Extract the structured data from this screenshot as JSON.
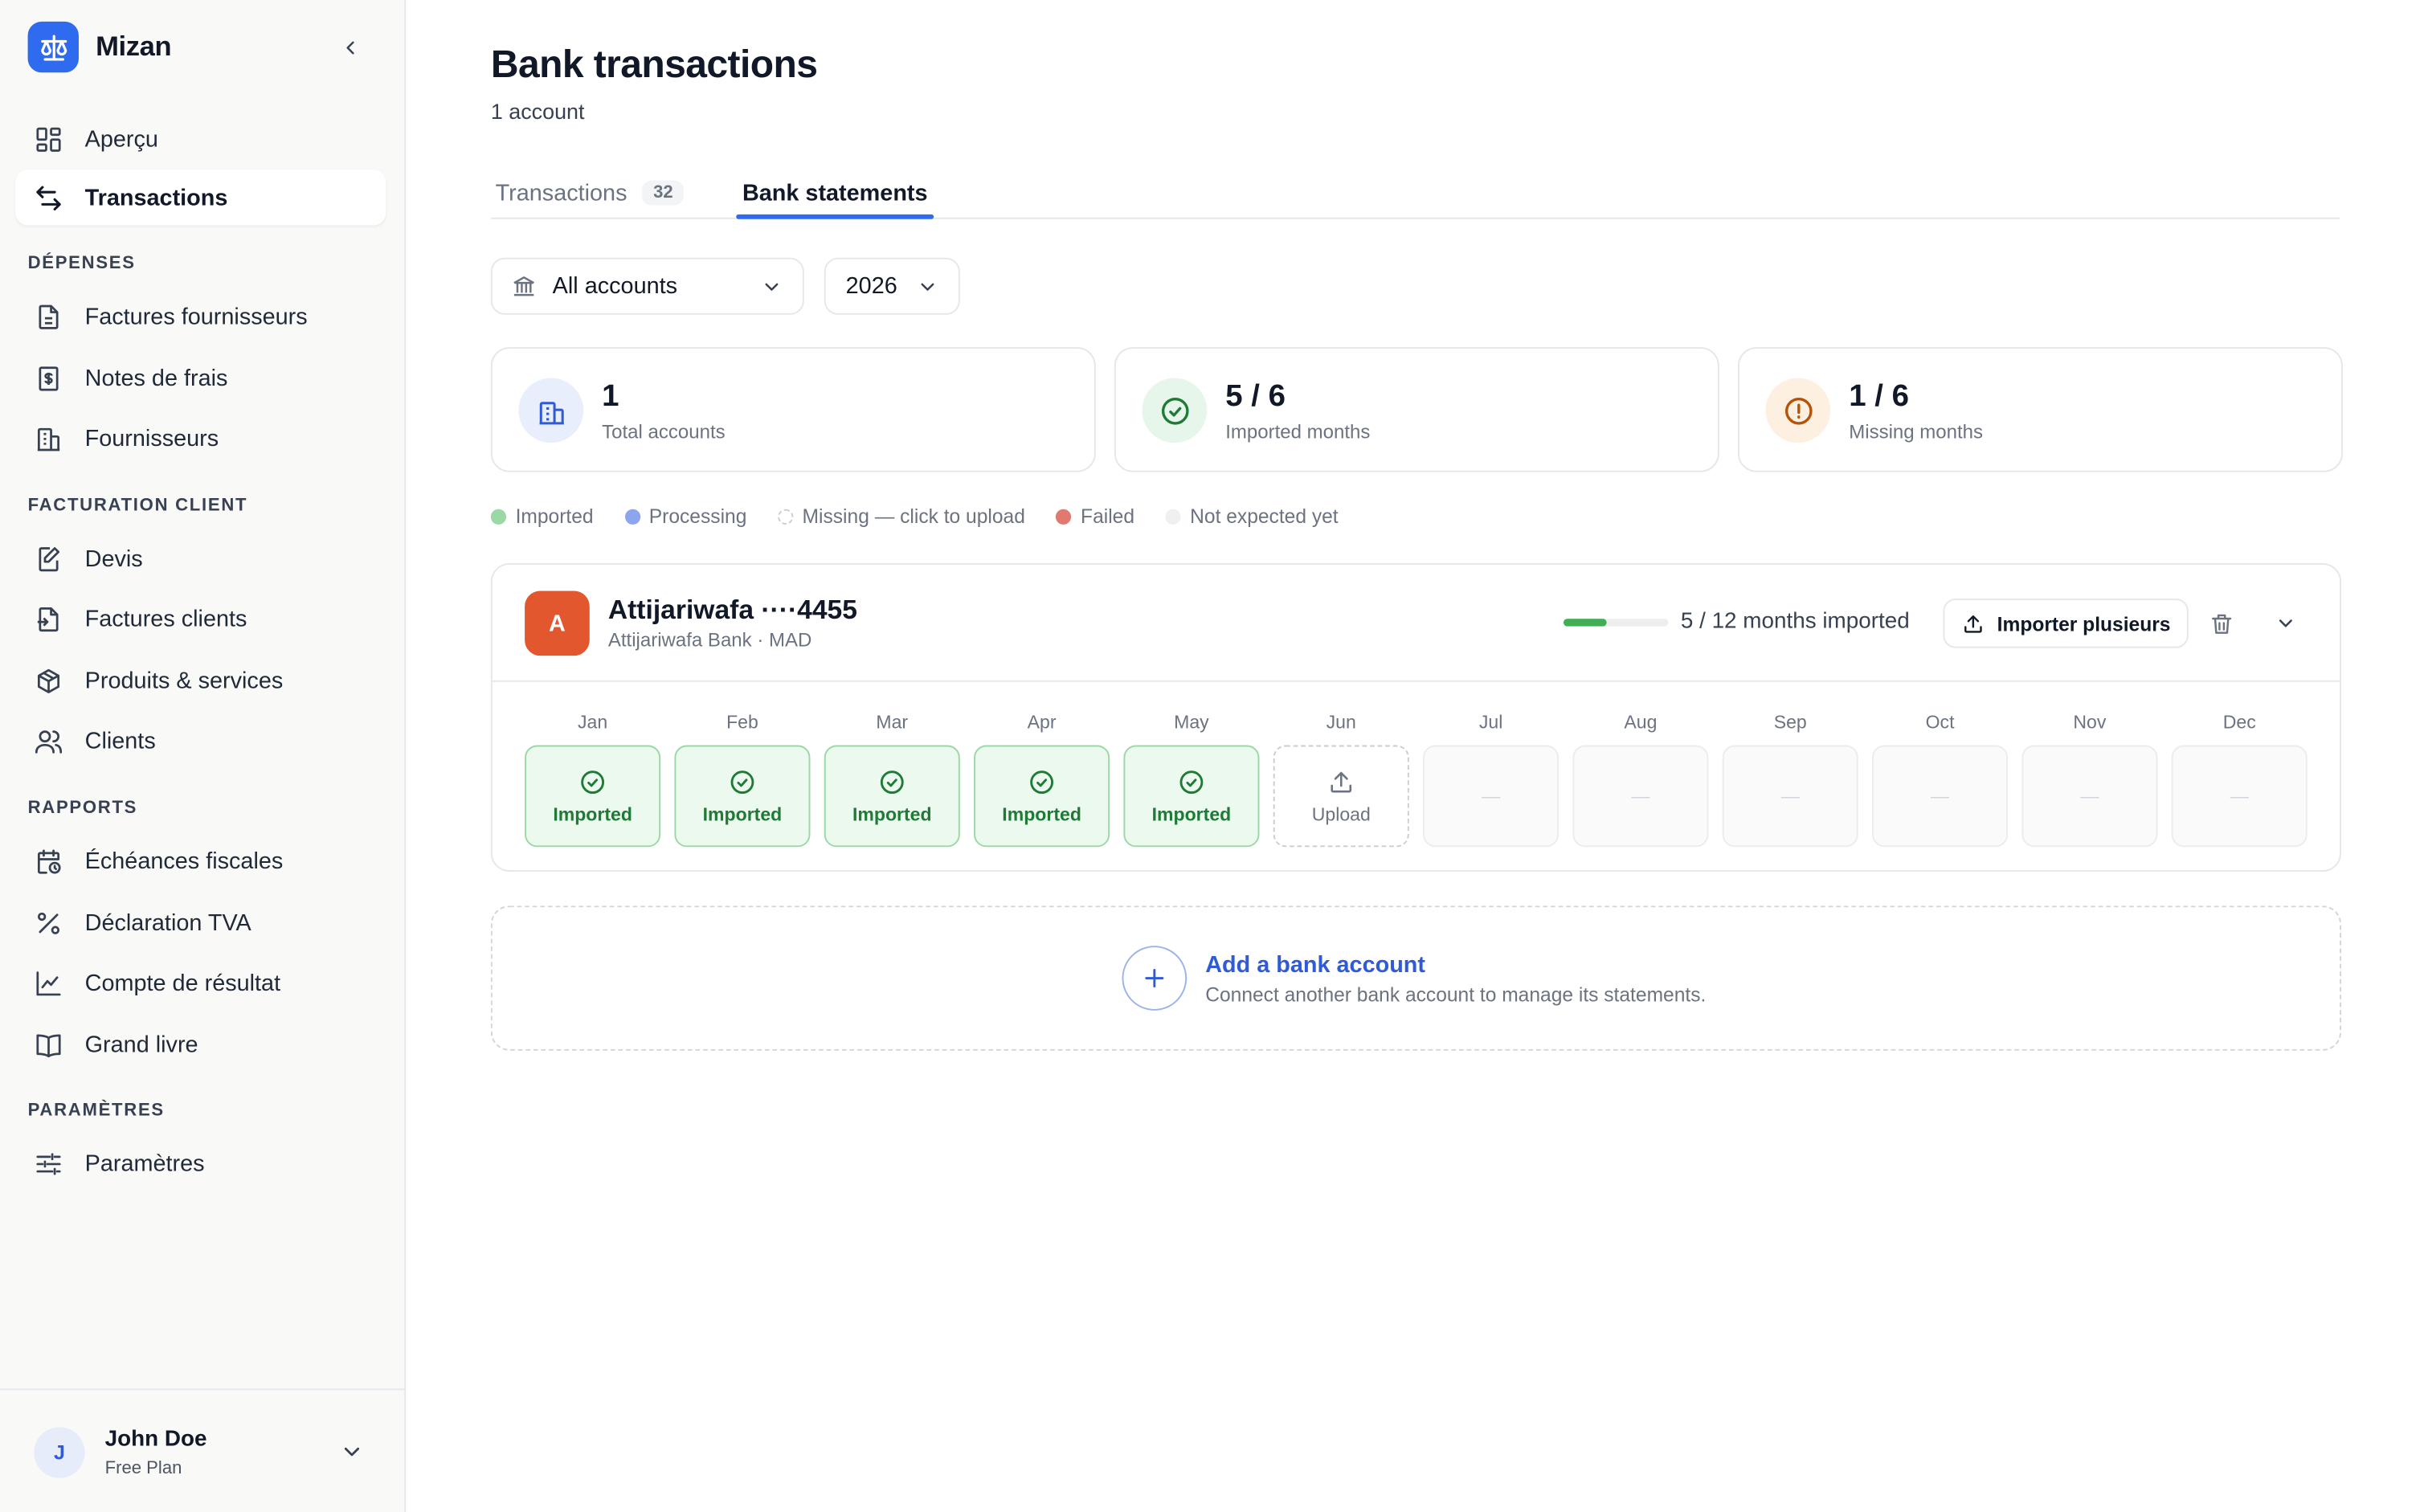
{
  "app": {
    "name": "Mizan"
  },
  "sidebar": {
    "top_items": [
      {
        "label": "Aperçu",
        "icon": "dashboard-icon"
      },
      {
        "label": "Transactions",
        "icon": "transfer-arrows-icon",
        "active": true
      }
    ],
    "sections": [
      {
        "title": "DÉPENSES",
        "items": [
          {
            "label": "Factures fournisseurs",
            "icon": "document-icon"
          },
          {
            "label": "Notes de frais",
            "icon": "dollar-receipt-icon"
          },
          {
            "label": "Fournisseurs",
            "icon": "building-icon"
          }
        ]
      },
      {
        "title": "FACTURATION CLIENT",
        "items": [
          {
            "label": "Devis",
            "icon": "edit-document-icon"
          },
          {
            "label": "Factures clients",
            "icon": "invoice-icon"
          },
          {
            "label": "Produits & services",
            "icon": "box-icon"
          },
          {
            "label": "Clients",
            "icon": "users-icon"
          }
        ]
      },
      {
        "title": "RAPPORTS",
        "items": [
          {
            "label": "Échéances fiscales",
            "icon": "calendar-clock-icon"
          },
          {
            "label": "Déclaration TVA",
            "icon": "percent-icon"
          },
          {
            "label": "Compte de résultat",
            "icon": "line-chart-icon"
          },
          {
            "label": "Grand livre",
            "icon": "book-icon"
          }
        ]
      },
      {
        "title": "PARAMÈTRES",
        "items": [
          {
            "label": "Paramètres",
            "icon": "sliders-icon"
          }
        ]
      }
    ],
    "user": {
      "initial": "J",
      "name": "John Doe",
      "plan": "Free Plan"
    }
  },
  "main": {
    "title": "Bank transactions",
    "subtitle": "1 account",
    "tabs": [
      {
        "label": "Transactions",
        "count": "32",
        "active": false
      },
      {
        "label": "Bank statements",
        "active": true
      }
    ],
    "filters": {
      "account": "All accounts",
      "year": "2026"
    },
    "stats": [
      {
        "value": "1",
        "label": "Total accounts",
        "icon": "bank-building-icon",
        "color": "#2f5bd6",
        "bg": "#e8eefc"
      },
      {
        "value": "5 / 6",
        "label": "Imported months",
        "icon": "check-circle-icon",
        "color": "#1f7a36",
        "bg": "#e6f6ea"
      },
      {
        "value": "1 / 6",
        "label": "Missing months",
        "icon": "alert-circle-icon",
        "color": "#b45309",
        "bg": "#fdf0e0"
      }
    ],
    "legend": [
      {
        "label": "Imported",
        "color": "#9ad8a6",
        "style": "solid"
      },
      {
        "label": "Processing",
        "color": "#8da5ee",
        "style": "solid"
      },
      {
        "label": "Missing — click to upload",
        "color": "#c9ccd1",
        "style": "dashed"
      },
      {
        "label": "Failed",
        "color": "#e07a70",
        "style": "solid"
      },
      {
        "label": "Not expected yet",
        "color": "#f0f0f0",
        "style": "solid"
      }
    ],
    "account": {
      "initial": "A",
      "name": "Attijariwafa ····4455",
      "bank_line": "Attijariwafa Bank · MAD",
      "progress_fraction": 0.4167,
      "progress_text": "5 / 12 months imported",
      "import_label": "Importer plusieurs",
      "months": [
        {
          "name": "Jan",
          "status": "imported",
          "label": "Imported"
        },
        {
          "name": "Feb",
          "status": "imported",
          "label": "Imported"
        },
        {
          "name": "Mar",
          "status": "imported",
          "label": "Imported"
        },
        {
          "name": "Apr",
          "status": "imported",
          "label": "Imported"
        },
        {
          "name": "May",
          "status": "imported",
          "label": "Imported"
        },
        {
          "name": "Jun",
          "status": "upload",
          "label": "Upload"
        },
        {
          "name": "Jul",
          "status": "future",
          "label": "—"
        },
        {
          "name": "Aug",
          "status": "future",
          "label": "—"
        },
        {
          "name": "Sep",
          "status": "future",
          "label": "—"
        },
        {
          "name": "Oct",
          "status": "future",
          "label": "—"
        },
        {
          "name": "Nov",
          "status": "future",
          "label": "—"
        },
        {
          "name": "Dec",
          "status": "future",
          "label": "—"
        }
      ]
    },
    "add_account": {
      "title": "Add a bank account",
      "subtitle": "Connect another bank account to manage its statements."
    }
  },
  "colors": {
    "accent": "#2f6bef",
    "success": "#3fae55"
  }
}
